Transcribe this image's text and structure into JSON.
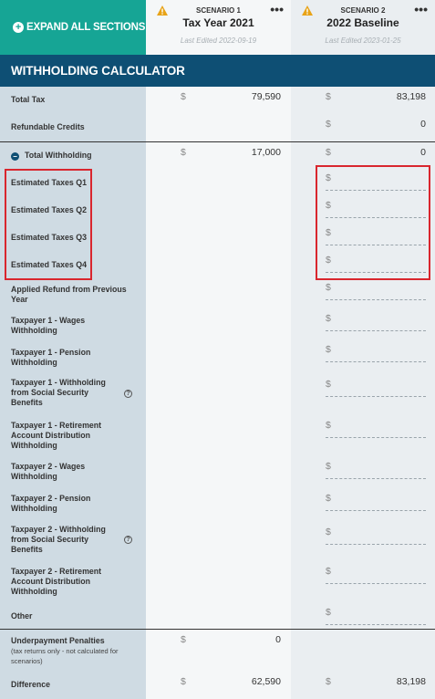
{
  "header": {
    "expand_label": "EXPAND ALL SECTIONS",
    "scenario1": {
      "number": "SCENARIO 1",
      "name": "Tax Year 2021",
      "edited": "Last Edited 2022-09-19"
    },
    "scenario2": {
      "number": "SCENARIO 2",
      "name": "2022 Baseline",
      "edited": "Last Edited 2023-01-25"
    },
    "menu_glyph": "•••"
  },
  "title": "WITHHOLDING CALCULATOR",
  "currency": "$",
  "rows": {
    "total_tax": {
      "label": "Total Tax",
      "s1": "79,590",
      "s2": "83,198"
    },
    "refundable_credits": {
      "label": "Refundable Credits",
      "s2": "0"
    },
    "total_withholding": {
      "label": "Total Withholding",
      "s1": "17,000",
      "s2": "0"
    },
    "est_q1": {
      "label": "Estimated Taxes Q1"
    },
    "est_q2": {
      "label": "Estimated Taxes Q2"
    },
    "est_q3": {
      "label": "Estimated Taxes Q3"
    },
    "est_q4": {
      "label": "Estimated Taxes Q4"
    },
    "applied_refund": {
      "label": "Applied Refund from Previous Year"
    },
    "tp1_wages": {
      "label": "Taxpayer 1 - Wages Withholding"
    },
    "tp1_pension": {
      "label": "Taxpayer 1 - Pension Withholding"
    },
    "tp1_ss": {
      "label": "Taxpayer 1 - Withholding from Social Security Benefits"
    },
    "tp1_retirement": {
      "label": "Taxpayer 1 - Retirement Account Distribution Withholding"
    },
    "tp2_wages": {
      "label": "Taxpayer 2 - Wages Withholding"
    },
    "tp2_pension": {
      "label": "Taxpayer 2 - Pension Withholding"
    },
    "tp2_ss": {
      "label": "Taxpayer 2 - Withholding from Social Security Benefits"
    },
    "tp2_retirement": {
      "label": "Taxpayer 2 - Retirement Account Distribution Withholding"
    },
    "other": {
      "label": "Other"
    },
    "underpayment": {
      "label": "Underpayment Penalties",
      "note": "(tax returns only - not calculated for scenarios)",
      "s1": "0"
    },
    "difference": {
      "label": "Difference",
      "s1": "62,590",
      "s2": "83,198"
    }
  },
  "colors": {
    "teal": "#16a595",
    "navy": "#0e4f74",
    "highlight": "#d9262e"
  },
  "icons": {
    "warning": "warning-icon",
    "menu": "more-icon",
    "expand": "plus-circle-icon",
    "collapse": "minus-circle-icon",
    "help": "help-icon"
  }
}
